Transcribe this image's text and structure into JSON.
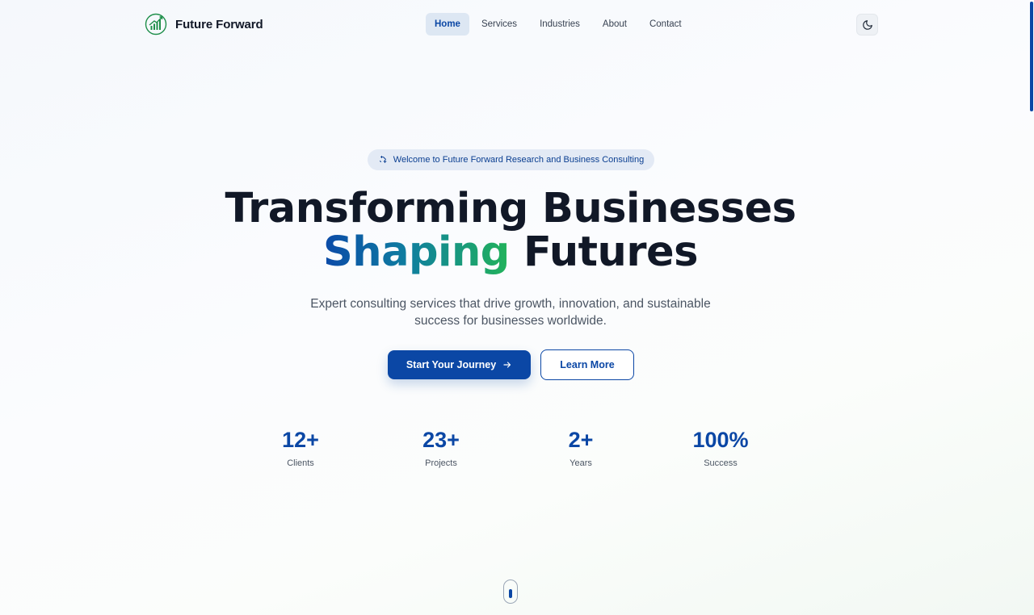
{
  "nav": {
    "brand_name": "Future Forward",
    "brand_icon": "growth-chart-logo",
    "items": [
      {
        "label": "Home",
        "active": true
      },
      {
        "label": "Services",
        "active": false
      },
      {
        "label": "Industries",
        "active": false
      },
      {
        "label": "About",
        "active": false
      },
      {
        "label": "Contact",
        "active": false
      }
    ],
    "theme_toggle_icon": "moon-icon"
  },
  "hero": {
    "badge_icon": "sparkles-icon",
    "badge_text": "Welcome to Future Forward Research and Business Consulting",
    "title_line1": "Transforming Businesses",
    "title_line2_highlight": "Shaping",
    "title_line2_rest": " Futures",
    "subtitle": "Expert consulting services that drive growth, innovation, and sustainable success for businesses worldwide.",
    "primary_button": "Start Your Journey",
    "primary_button_icon": "arrow-right-icon",
    "secondary_button": "Learn More"
  },
  "stats": [
    {
      "value": "12+",
      "label": "Clients"
    },
    {
      "value": "23+",
      "label": "Projects"
    },
    {
      "value": "2+",
      "label": "Years"
    },
    {
      "value": "100%",
      "label": "Success"
    }
  ],
  "colors": {
    "primary": "#0b47a5",
    "gradient_start": "#0b4aa8",
    "gradient_end": "#22b35a",
    "text_dark": "#111827",
    "text_muted": "#4b5563"
  },
  "scroll_indicator_icon": "mouse-scroll-icon"
}
